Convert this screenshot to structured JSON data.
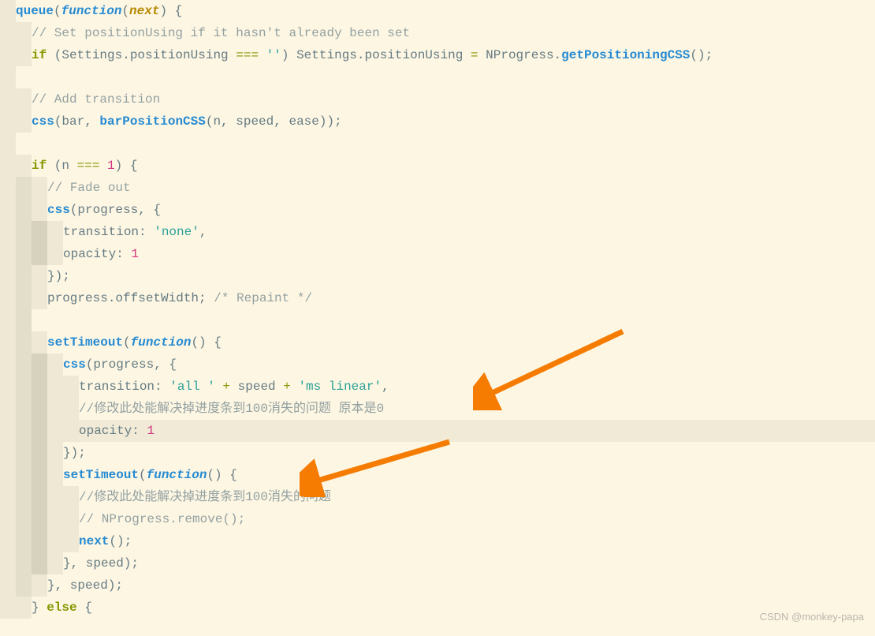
{
  "watermark": "CSDN @monkey-papa",
  "lines": {
    "l1": {
      "a": "queue",
      "b": "(",
      "c": "function",
      "d": "(",
      "e": "next",
      "f": ") {"
    },
    "l2": {
      "a": "// Set positionUsing if it hasn't already been set"
    },
    "l3": {
      "a": "if",
      "b": " (Settings.positionUsing ",
      "c": "===",
      "d": " ",
      "e": "''",
      "f": ") Settings.positionUsing ",
      "g": "=",
      "h": " NProgress.",
      "i": "getPositioningCSS",
      "j": "();"
    },
    "l4": "",
    "l5": {
      "a": "// Add transition"
    },
    "l6": {
      "a": "css",
      "b": "(bar, ",
      "c": "barPositionCSS",
      "d": "(n, speed, ease));"
    },
    "l7": "",
    "l8": {
      "a": "if",
      "b": " (n ",
      "c": "===",
      "d": " ",
      "e": "1",
      "f": ") {"
    },
    "l9": {
      "a": "// Fade out"
    },
    "l10": {
      "a": "css",
      "b": "(progress, {"
    },
    "l11": {
      "a": "transition: ",
      "b": "'none'",
      "c": ","
    },
    "l12": {
      "a": "opacity: ",
      "b": "1"
    },
    "l13": {
      "a": "});"
    },
    "l14": {
      "a": "progress.offsetWidth; ",
      "b": "/* Repaint */"
    },
    "l15": "",
    "l16": {
      "a": "setTimeout",
      "b": "(",
      "c": "function",
      "d": "() {"
    },
    "l17": {
      "a": "css",
      "b": "(progress, {"
    },
    "l18": {
      "a": "transition: ",
      "b": "'all '",
      "c": " + ",
      "d": "speed ",
      "e": "+ ",
      "f": "'ms linear'",
      "g": ","
    },
    "l19": {
      "a": "//修改此处能解决掉进度条到100消失的问题 原本是0"
    },
    "l20": {
      "a": "opacity: ",
      "b": "1"
    },
    "l21": {
      "a": "});"
    },
    "l22": {
      "a": "setTimeout",
      "b": "(",
      "c": "function",
      "d": "() {"
    },
    "l23": {
      "a": "//修改此处能解决掉进度条到100消失的问题"
    },
    "l24": {
      "a": "// NProgress.remove();"
    },
    "l25": {
      "a": "next",
      "b": "();"
    },
    "l26": {
      "a": "}, speed);"
    },
    "l27": {
      "a": "}, speed);"
    },
    "l28": {
      "a": "} ",
      "b": "else",
      "c": " {"
    }
  }
}
